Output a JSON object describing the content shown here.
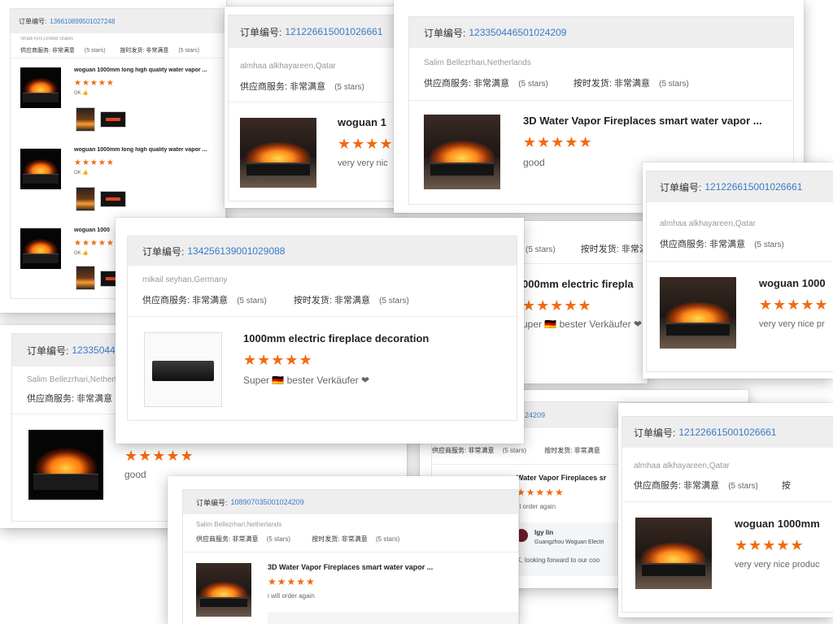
{
  "colors": {
    "order_number": "#3b79c6",
    "stars": "#f26a10",
    "header_bg": "#eeeeee"
  },
  "labels": {
    "order": "订单编号:",
    "supplier_service": "供应商服务:",
    "on_time_delivery": "按时发货:",
    "very_satisfied": "非常满意",
    "five_stars": "(5 stars)"
  },
  "stars": "★★★★★",
  "cards": {
    "a": {
      "order_number": "1366108995010272​48",
      "buyer": "Shadi Kris,United States",
      "items": [
        {
          "title": "woguan 1000mm long high quality water vapor ...",
          "comment": "OK 👍"
        },
        {
          "title": "woguan 1000mm long high quality water vapor ...",
          "comment": "OK 👍"
        },
        {
          "title": "woguan 1000",
          "comment": "OK 👍"
        }
      ]
    },
    "b": {
      "order_number": "1212266150010266​61",
      "buyer": "almhaa alkhayareen,Qatar",
      "product": "woguan 1",
      "comment": "very very nic"
    },
    "c": {
      "order_number": "123350446501024209",
      "buyer": "Salim Bellezrhari,Netherlands",
      "product": "3D Water Vapor Fireplaces smart water vapor ...",
      "comment": "good"
    },
    "d": {
      "order_number": "121226615001026661",
      "buyer": "almhaa alkhayareen,Qatar",
      "product": "woguan 1000",
      "comment": "very very nice pr"
    },
    "e": {
      "order_number": "12335044650102420",
      "buyer": "Salim Bellezrhari,Netherla",
      "product": "",
      "comment": "good"
    },
    "f": {
      "partial_stars": "(5 stars)",
      "product": "000mm electric firepla",
      "comment": "uper 🇩🇪 bester Verkäufer ❤"
    },
    "g": {
      "order_number": "134256139001029088",
      "buyer": "mikail seyhan,Germany",
      "product": "1000mm electric fireplace decoration",
      "comment": "Super 🇩🇪 bester Verkäufer ❤"
    },
    "h": {
      "order_number": "24209",
      "product": "Water Vapor Fireplaces sr",
      "comment": "ill order again",
      "reply_name": "Igy lin",
      "reply_company": "Guangzhou Woguan Electri",
      "reply_text": "OK, looking forward to our coo"
    },
    "i": {
      "order_number": "121226615001026661",
      "buyer": "almhaa alkhayareen,Qatar",
      "product": "woguan 1000mm",
      "comment": "very very nice produc"
    },
    "j": {
      "order_number": "108907035001024209",
      "buyer": "Salim Bellezrhari,Netherlands",
      "product": "3D Water Vapor Fireplaces smart water vapor ...",
      "comment": "i will order again"
    }
  }
}
